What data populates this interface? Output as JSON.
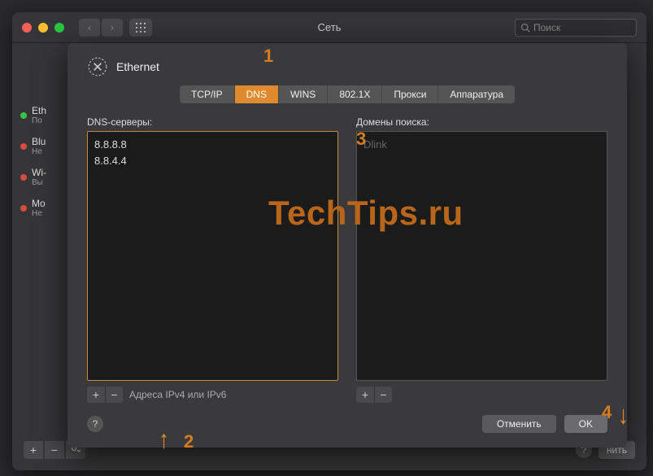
{
  "parent_window": {
    "title": "Сеть",
    "search_placeholder": "Поиск",
    "sidebar": [
      {
        "label": "Eth",
        "sub": "По",
        "status": "green"
      },
      {
        "label": "Blu",
        "sub": "Не",
        "status": "red"
      },
      {
        "label": "Wi-",
        "sub": "Вы",
        "status": "red"
      },
      {
        "label": "Mo",
        "sub": "Не",
        "status": "red"
      }
    ],
    "apply_partial": "нить"
  },
  "sheet": {
    "interface": "Ethernet",
    "tabs": [
      "TCP/IP",
      "DNS",
      "WINS",
      "802.1X",
      "Прокси",
      "Аппаратура"
    ],
    "active_tab": "DNS",
    "dns": {
      "label": "DNS-серверы:",
      "servers": [
        "8.8.8.8",
        "8.8.4.4"
      ],
      "hint": "Адреса IPv4 или IPv6"
    },
    "search_domains": {
      "label": "Домены поиска:",
      "placeholder": "Dlink"
    },
    "buttons": {
      "cancel": "Отменить",
      "ok": "OK"
    }
  },
  "annotations": {
    "watermark": "TechTips.ru",
    "n1": "1",
    "n2": "2",
    "n3": "3",
    "n4": "4"
  }
}
